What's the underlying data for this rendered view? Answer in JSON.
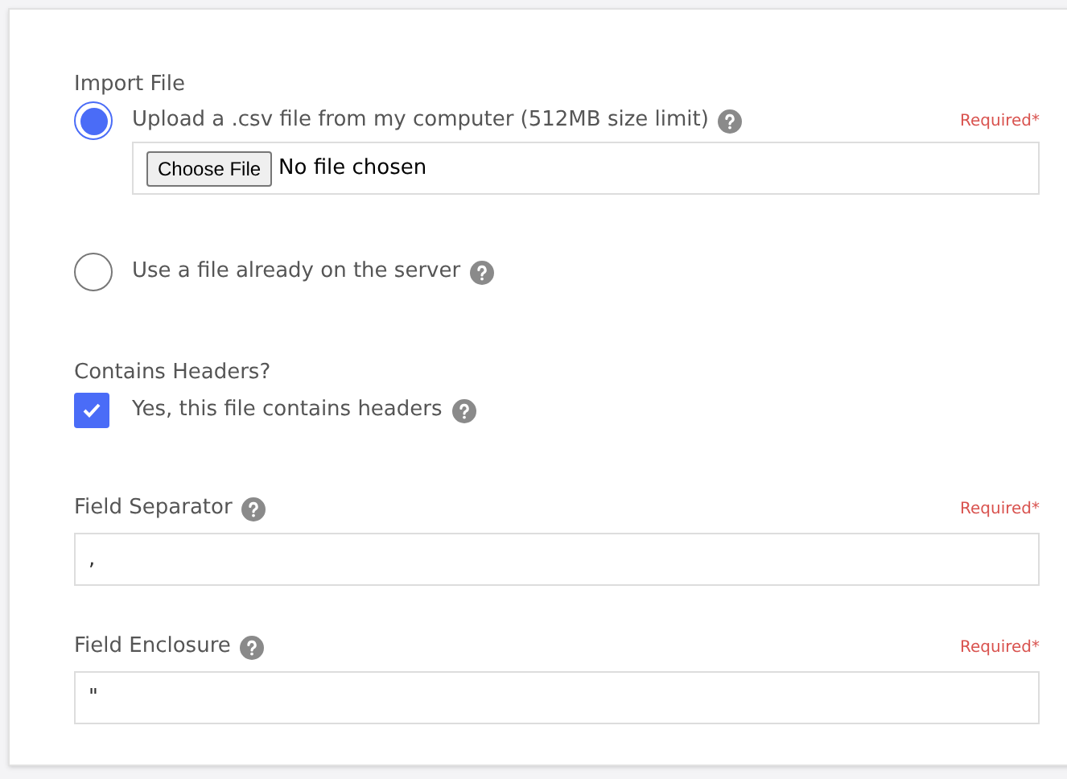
{
  "import_file": {
    "label": "Import File",
    "options": [
      {
        "kind": "upload",
        "label": "Upload a .csv file from my computer (512MB size limit)",
        "selected": true,
        "required": "Required*",
        "button": "Choose File",
        "status": "No file chosen"
      },
      {
        "kind": "plain",
        "label": "Use a file already on the server",
        "selected": false
      }
    ]
  },
  "headers": {
    "label": "Contains Headers?",
    "checkbox": {
      "label": "Yes, this file contains headers",
      "checked": true
    }
  },
  "fields": [
    {
      "label": "Field Separator",
      "required": "Required*",
      "value": ","
    },
    {
      "label": "Field Enclosure",
      "required": "Required*",
      "value": "\""
    }
  ]
}
